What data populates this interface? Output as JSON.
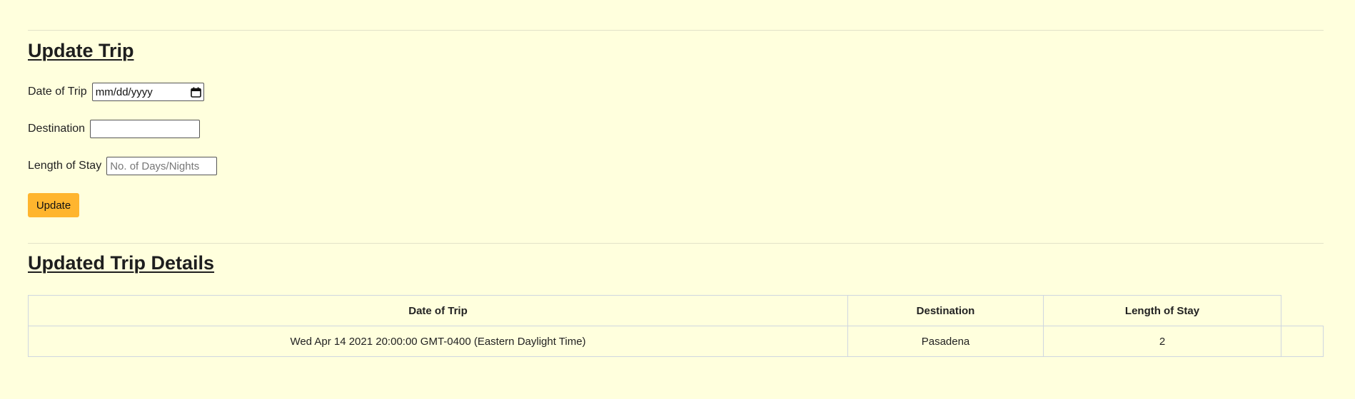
{
  "update_form": {
    "heading": "Update Trip",
    "date_label": "Date of Trip",
    "date_placeholder": "mm/dd/yyyy",
    "date_icon": "calendar-icon",
    "destination_label": "Destination",
    "destination_value": "",
    "length_label": "Length of Stay",
    "length_placeholder": "No. of Days/Nights",
    "update_button": "Update",
    "button_color": "#ffb52e"
  },
  "details": {
    "heading": "Updated Trip Details",
    "columns": [
      "Date of Trip",
      "Destination",
      "Length of Stay"
    ],
    "rows": [
      {
        "date": "Wed Apr 14 2021 20:00:00 GMT-0400 (Eastern Daylight Time)",
        "destination": "Pasadena",
        "length": "2"
      }
    ]
  },
  "colors": {
    "background": "#ffffdd",
    "table_border": "#cfd6e0"
  }
}
